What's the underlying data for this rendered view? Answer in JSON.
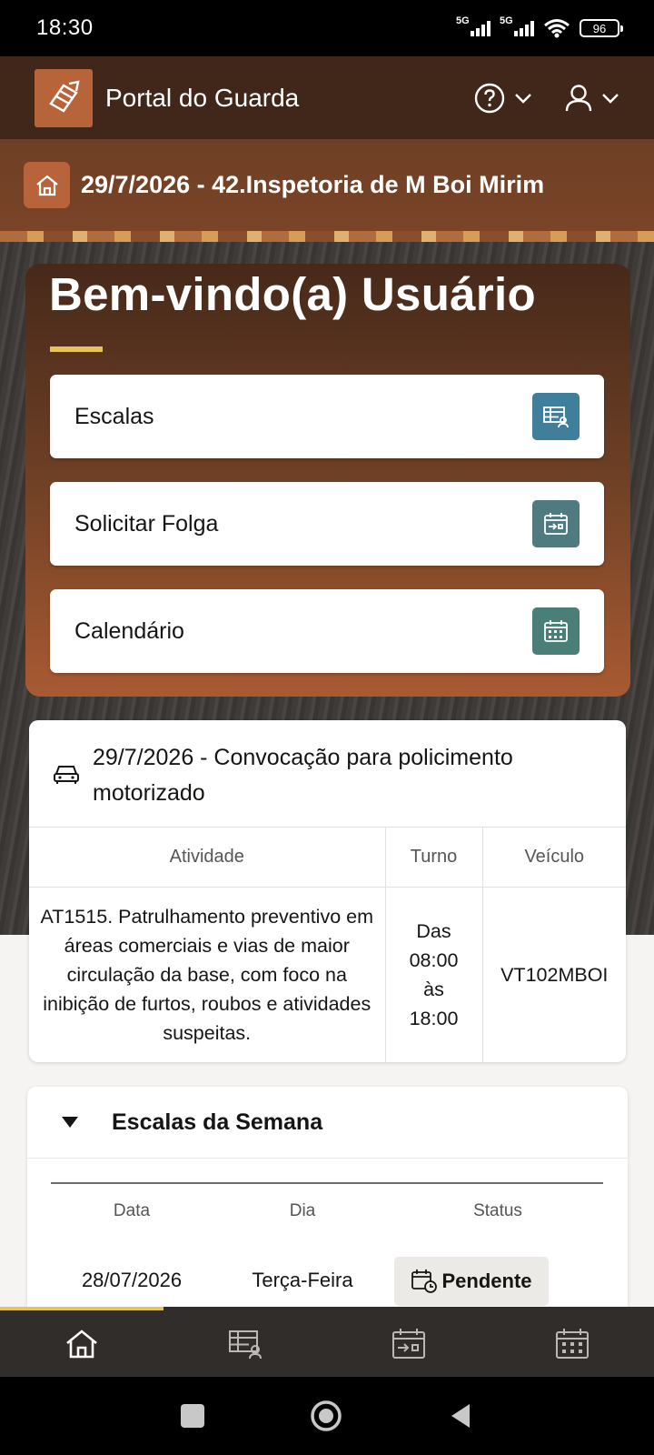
{
  "status_bar": {
    "time": "18:30",
    "network_1": "5G",
    "network_2": "5G",
    "battery": "96"
  },
  "header": {
    "title": "Portal do Guarda"
  },
  "breadcrumb": {
    "text": "29/7/2026 - 42.Inspetoria de M Boi Mirim"
  },
  "welcome": {
    "heading": "Bem-vindo(a) Usuário",
    "actions": [
      {
        "label": "Escalas",
        "icon": "schedule-icon",
        "color": "#3f7f9b"
      },
      {
        "label": "Solicitar Folga",
        "icon": "calendar-transfer-icon",
        "color": "#4e7a80"
      },
      {
        "label": "Calendário",
        "icon": "calendar-grid-icon",
        "color": "#4a7f78"
      }
    ]
  },
  "convocation": {
    "title": "29/7/2026 - Convocação para policimento motorizado",
    "columns": [
      "Atividade",
      "Turno",
      "Veículo"
    ],
    "row": {
      "atividade": "AT1515. Patrulhamento preventivo em áreas comerciais e vias de maior circulação da base, com foco na inibição de furtos, roubos e atividades suspeitas.",
      "turno": [
        "Das",
        "08:00",
        "às",
        "18:00"
      ],
      "veiculo": "VT102MBOI"
    }
  },
  "week": {
    "title": "Escalas da Semana",
    "columns": [
      "Data",
      "Dia",
      "Status"
    ],
    "rows": [
      {
        "data": "28/07/2026",
        "dia": "Terça-Feira",
        "status": "Pendente"
      }
    ]
  },
  "bottom_nav": [
    "home-icon",
    "schedule-icon",
    "calendar-transfer-icon",
    "calendar-grid-icon"
  ],
  "colors": {
    "header_bg": "#41271a",
    "accent_gold": "#e6c35c",
    "brand_orange": "#b8643a"
  }
}
